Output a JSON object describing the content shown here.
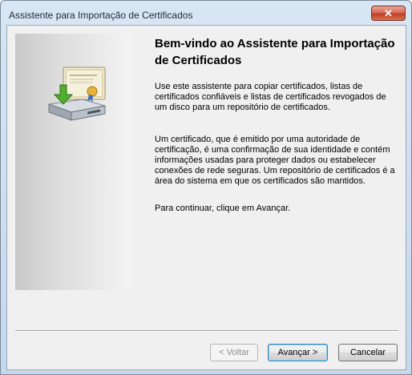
{
  "window": {
    "title": "Assistente para Importação de Certificados",
    "close_label": "✕"
  },
  "content": {
    "heading": "Bem-vindo ao Assistente para Importação de Certificados",
    "paragraph1": "Use este assistente para copiar certificados, listas de certificados confiáveis e listas de certificados revogados de um disco para um repositório de certificados.",
    "paragraph2": "Um certificado, que é emitido por uma autoridade de certificação, é uma confirmação de sua identidade e contém informações usadas para proteger dados ou estabelecer conexões de rede seguras. Um repositório de certificados é a área do sistema em que os certificados são mantidos.",
    "paragraph3": "Para continuar, clique em Avançar."
  },
  "buttons": {
    "back": "< Voltar",
    "next": "Avançar >",
    "cancel": "Cancelar"
  },
  "icons": {
    "wizard": "certificate-import-icon"
  }
}
